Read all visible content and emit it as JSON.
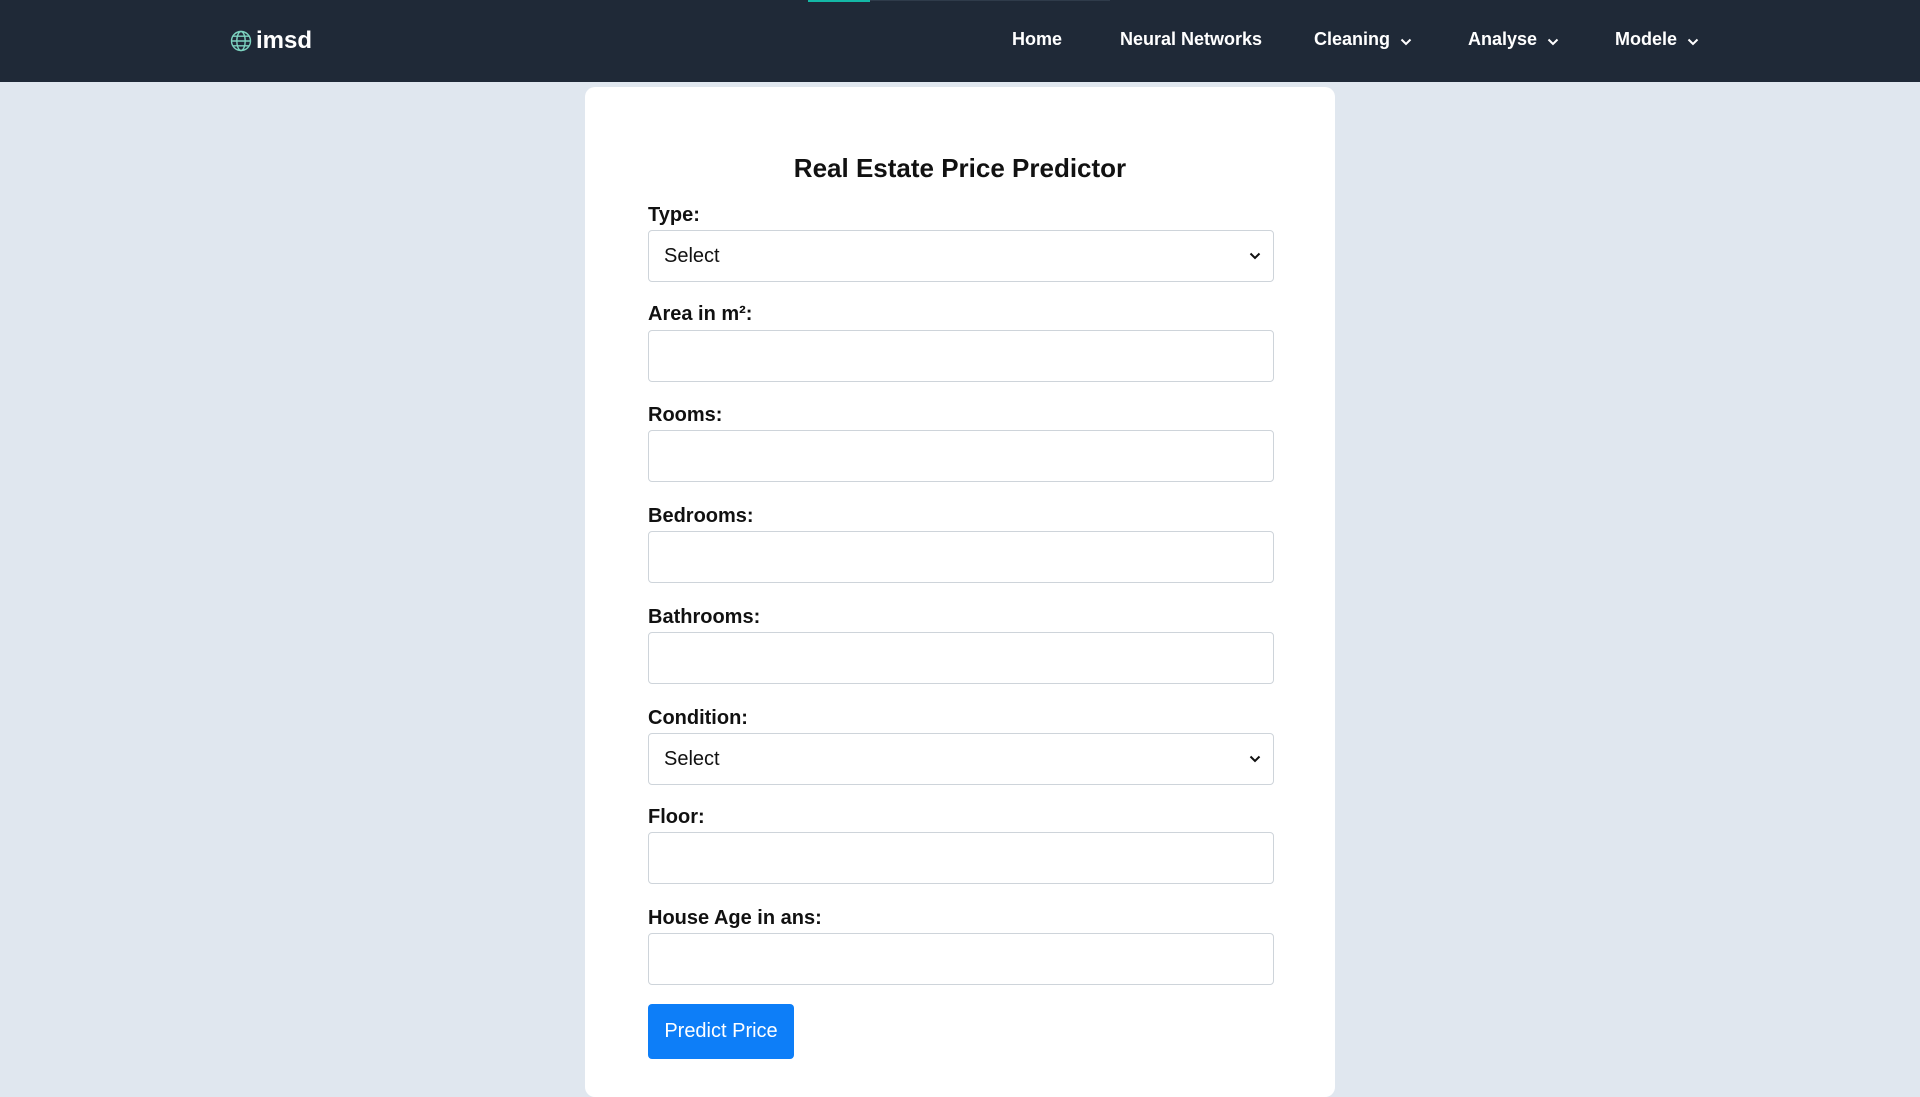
{
  "nav": {
    "brand": "imsd",
    "brand_icon": "globe-icon",
    "links": [
      {
        "label": "Home",
        "dropdown": false
      },
      {
        "label": "Neural Networks",
        "dropdown": false
      },
      {
        "label": "Cleaning",
        "dropdown": true
      },
      {
        "label": "Analyse",
        "dropdown": true
      },
      {
        "label": "Modele",
        "dropdown": true
      }
    ],
    "background": "#1f2937",
    "accent": "#14b8a6"
  },
  "form": {
    "title": "Real Estate Price Predictor",
    "fields": {
      "type": {
        "label": "Type:",
        "value": "Select"
      },
      "area": {
        "label": "Area in m²:",
        "value": "",
        "placeholder": ""
      },
      "rooms": {
        "label": "Rooms:",
        "value": "",
        "placeholder": ""
      },
      "bedrooms": {
        "label": "Bedrooms:",
        "value": "",
        "placeholder": ""
      },
      "bathrooms": {
        "label": "Bathrooms:",
        "value": "",
        "placeholder": ""
      },
      "condition": {
        "label": "Condition:",
        "value": "Select"
      },
      "floor": {
        "label": "Floor:",
        "value": "",
        "placeholder": ""
      },
      "house_age": {
        "label": "House Age in ans:",
        "value": "",
        "placeholder": ""
      }
    },
    "submit_label": "Predict Price",
    "submit_color": "#0d7ef8"
  },
  "page": {
    "background": "#e0e7ef"
  }
}
